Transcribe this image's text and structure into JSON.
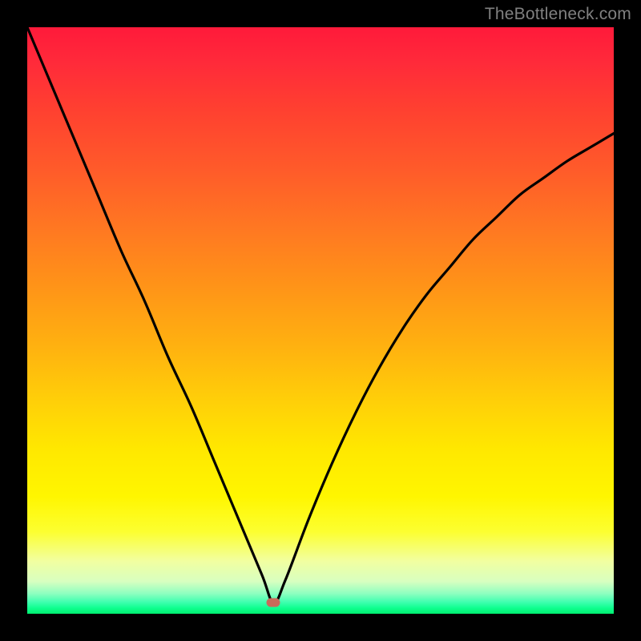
{
  "watermark": "TheBottleneck.com",
  "chart_data": {
    "type": "line",
    "title": "",
    "xlabel": "",
    "ylabel": "",
    "xlim": [
      0,
      100
    ],
    "ylim": [
      0,
      105
    ],
    "grid": false,
    "legend": false,
    "description": "Bottleneck curve: y≈|perf_diff|% vs x position. Gradient background: red (high bottleneck) at top → green (no bottleneck) at bottom. Minimum near x≈42 where marker sits.",
    "series": [
      {
        "name": "bottleneck-curve",
        "x": [
          0,
          4,
          8,
          12,
          16,
          20,
          24,
          28,
          32,
          36,
          40,
          42,
          44,
          48,
          52,
          56,
          60,
          64,
          68,
          72,
          76,
          80,
          84,
          88,
          92,
          96,
          100
        ],
        "values": [
          105,
          95,
          85,
          75,
          65,
          56,
          46,
          37,
          27,
          17,
          7,
          2,
          6,
          17,
          27,
          36,
          44,
          51,
          57,
          62,
          67,
          71,
          75,
          78,
          81,
          83.5,
          86
        ]
      }
    ],
    "marker": {
      "x": 42,
      "y": 2
    },
    "gradient_stops": [
      {
        "pct": 0,
        "color": "#ff1a3a"
      },
      {
        "pct": 50,
        "color": "#ffc800"
      },
      {
        "pct": 85,
        "color": "#f5ff60"
      },
      {
        "pct": 100,
        "color": "#00ef70"
      }
    ]
  }
}
